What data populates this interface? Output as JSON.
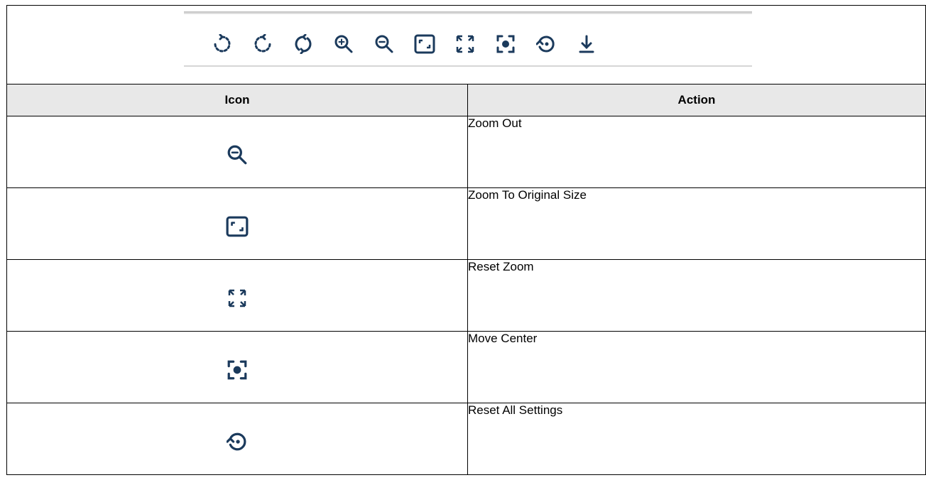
{
  "toolbar": {
    "icons": [
      "rotate-left-icon",
      "rotate-right-icon",
      "rotate-refresh-icon",
      "zoom-in-icon",
      "zoom-out-icon",
      "original-size-icon",
      "reset-zoom-icon",
      "move-center-icon",
      "reset-settings-icon",
      "download-icon"
    ]
  },
  "table": {
    "headers": {
      "icon": "Icon",
      "action": "Action"
    },
    "rows": [
      {
        "icon": "zoom-out-icon",
        "action": "Zoom Out"
      },
      {
        "icon": "original-size-icon",
        "action": "Zoom To Original Size"
      },
      {
        "icon": "reset-zoom-icon",
        "action": "Reset Zoom"
      },
      {
        "icon": "move-center-icon",
        "action": "Move Center"
      },
      {
        "icon": "reset-settings-icon",
        "action": "Reset All Settings"
      }
    ]
  },
  "colors": {
    "icon": "#1b3a5c",
    "header_bg": "#e8e8e8",
    "border": "#000000"
  }
}
